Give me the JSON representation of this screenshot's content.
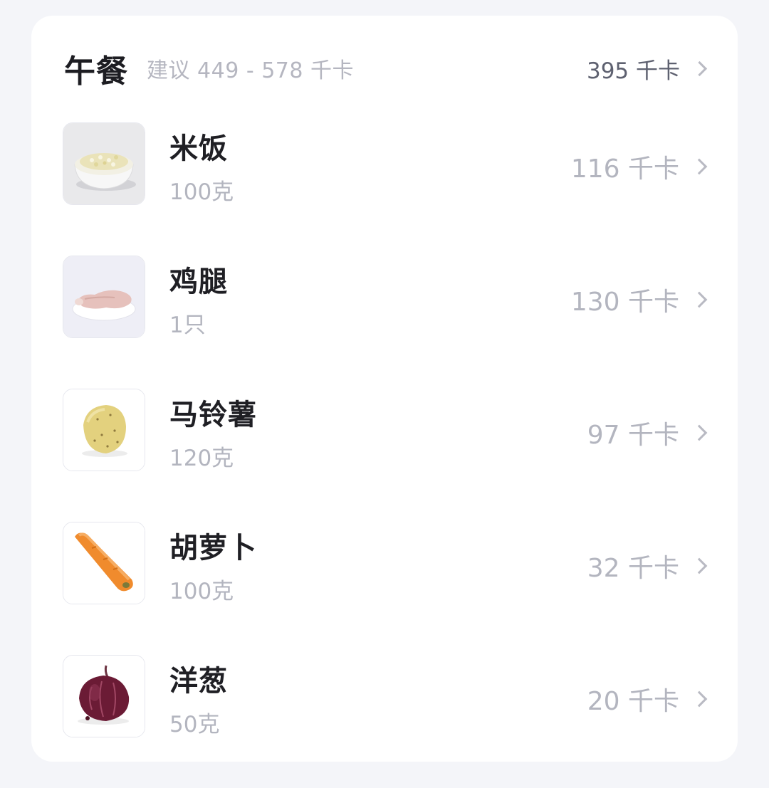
{
  "meal": {
    "title": "午餐",
    "suggestion": "建议 449 - 578 千卡",
    "total": "395 千卡",
    "total_icon": "chevron-right-icon"
  },
  "foods": [
    {
      "name": "米饭",
      "amount": "100克",
      "kcal": "116 千卡",
      "icon": "rice-bowl-icon"
    },
    {
      "name": "鸡腿",
      "amount": "1只",
      "kcal": "130 千卡",
      "icon": "chicken-leg-icon"
    },
    {
      "name": "马铃薯",
      "amount": "120克",
      "kcal": "97 千卡",
      "icon": "potato-icon"
    },
    {
      "name": "胡萝卜",
      "amount": "100克",
      "kcal": "32 千卡",
      "icon": "carrot-icon"
    },
    {
      "name": "洋葱",
      "amount": "50克",
      "kcal": "20 千卡",
      "icon": "onion-icon"
    }
  ]
}
